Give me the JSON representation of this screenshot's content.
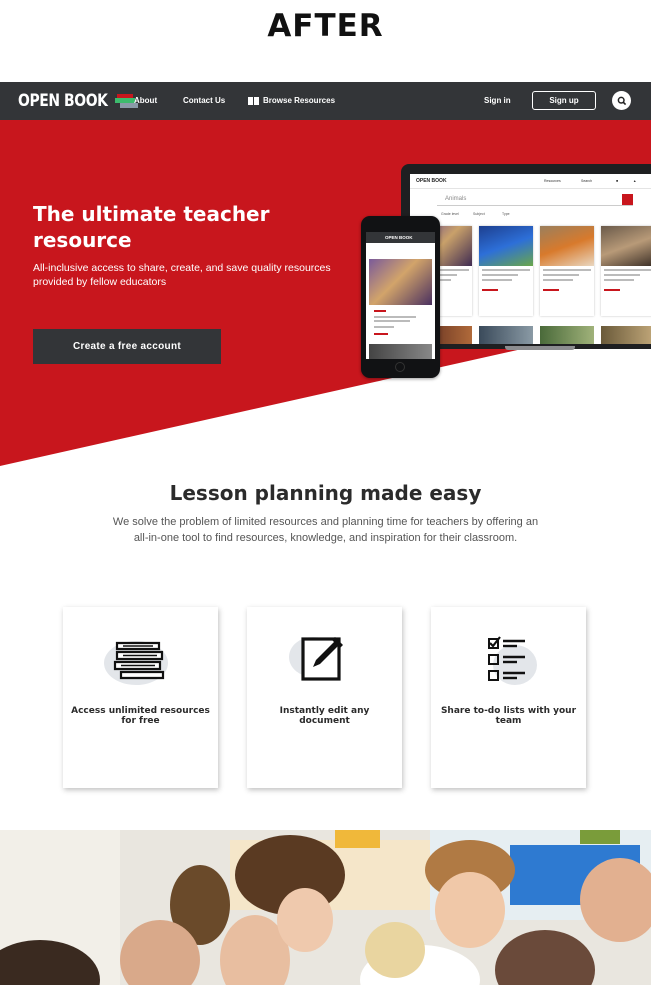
{
  "page_label": "AFTER",
  "brand": {
    "logo_text": "OPEN BOOK",
    "red": "#c8161d",
    "dark": "#333538"
  },
  "nav": {
    "about": "About",
    "contact": "Contact Us",
    "browse": "Browse Resources",
    "sign_in": "Sign in",
    "sign_up": "Sign up",
    "search_icon": "search-icon"
  },
  "hero": {
    "title": "The ultimate teacher resource",
    "subtitle": "All-inclusive access to share, create, and save quality resources provided by fellow educators",
    "cta": "Create a free account"
  },
  "mockup": {
    "laptop_logo": "OPEN BOOK",
    "laptop_nav": [
      "Resources",
      "Search"
    ],
    "search_value": "Animals",
    "filters": [
      "Grade level",
      "Subject",
      "Type"
    ],
    "phone_logo": "OPEN BOOK"
  },
  "section": {
    "title": "Lesson planning made easy",
    "description": "We solve the problem of limited resources and planning time for teachers by offering an all-in-one tool to find resources, knowledge, and inspiration for their classroom."
  },
  "features": [
    {
      "icon": "stacked-books-icon",
      "label": "Access unlimited resources for free"
    },
    {
      "icon": "edit-document-icon",
      "label": "Instantly edit any document"
    },
    {
      "icon": "checklist-icon",
      "label": "Share to-do lists with your team"
    }
  ]
}
